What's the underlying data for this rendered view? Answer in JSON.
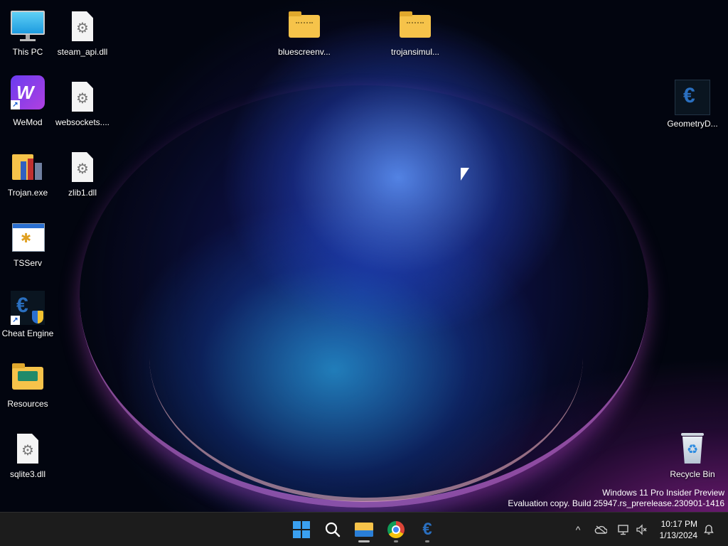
{
  "desktop": {
    "icons": [
      {
        "label": "This PC"
      },
      {
        "label": "steam_api.dll"
      },
      {
        "label": "bluescreenv..."
      },
      {
        "label": "trojansimul..."
      },
      {
        "label": "WeMod"
      },
      {
        "label": "websockets...."
      },
      {
        "label": "GeometryD..."
      },
      {
        "label": "Trojan.exe"
      },
      {
        "label": "zlib1.dll"
      },
      {
        "label": "TSServ"
      },
      {
        "label": "Cheat Engine"
      },
      {
        "label": "Resources"
      },
      {
        "label": "sqlite3.dll"
      },
      {
        "label": "Recycle Bin"
      }
    ]
  },
  "watermark": {
    "line1": "Windows 11 Pro Insider Preview",
    "line2": "Evaluation copy. Build 25947.rs_prerelease.230901-1416"
  },
  "taskbar": {
    "pinned": [
      "start-icon",
      "search-icon",
      "file-explorer-icon",
      "chrome-icon",
      "cheat-engine-icon"
    ],
    "tray": {
      "overflow_glyph": "^",
      "clock_time": "10:17 PM",
      "clock_date": "1/13/2024"
    }
  },
  "colors": {
    "taskbar_bg": "#1c1c1c",
    "start_blue": "#3aa0f0",
    "folder_yellow": "#f6c34a"
  }
}
